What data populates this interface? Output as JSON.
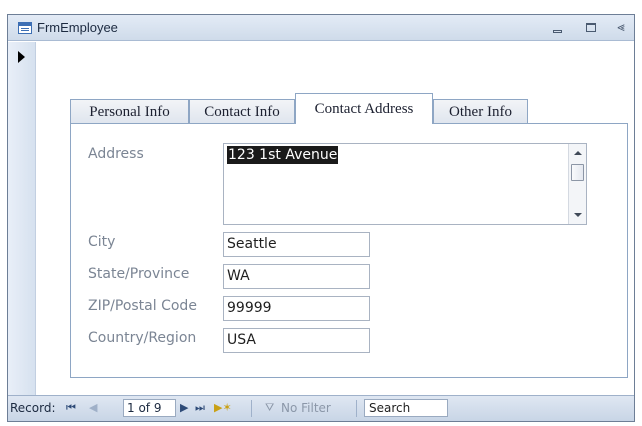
{
  "window": {
    "title": "FrmEmployee"
  },
  "tabs": [
    {
      "label": "Personal Info"
    },
    {
      "label": "Contact Info"
    },
    {
      "label": "Contact Address"
    },
    {
      "label": "Other Info"
    }
  ],
  "active_tab": "Contact Address",
  "form": {
    "address": {
      "label": "Address",
      "value": "123 1st Avenue"
    },
    "city": {
      "label": "City",
      "value": "Seattle"
    },
    "state": {
      "label": "State/Province",
      "value": "WA"
    },
    "zip": {
      "label": "ZIP/Postal Code",
      "value": "99999"
    },
    "country": {
      "label": "Country/Region",
      "value": "USA"
    }
  },
  "navigation": {
    "label": "Record:",
    "record_position": "1 of 9",
    "filter_label": "No Filter",
    "search_label": "Search"
  },
  "icons": {
    "app": "form-icon",
    "minimize": "minimize-icon",
    "restore": "restore-icon",
    "close": "close-icon",
    "record_selector": "current-record-arrow-icon",
    "first": "first-record-icon",
    "previous": "previous-record-icon",
    "next": "next-record-icon",
    "last": "last-record-icon",
    "new": "new-record-icon",
    "filter": "filter-icon"
  },
  "colors": {
    "titlebar": "#d9e4f2",
    "tab_border": "#8ea6c4",
    "label_text": "#7b8594",
    "selection": "#1a1a1a"
  }
}
